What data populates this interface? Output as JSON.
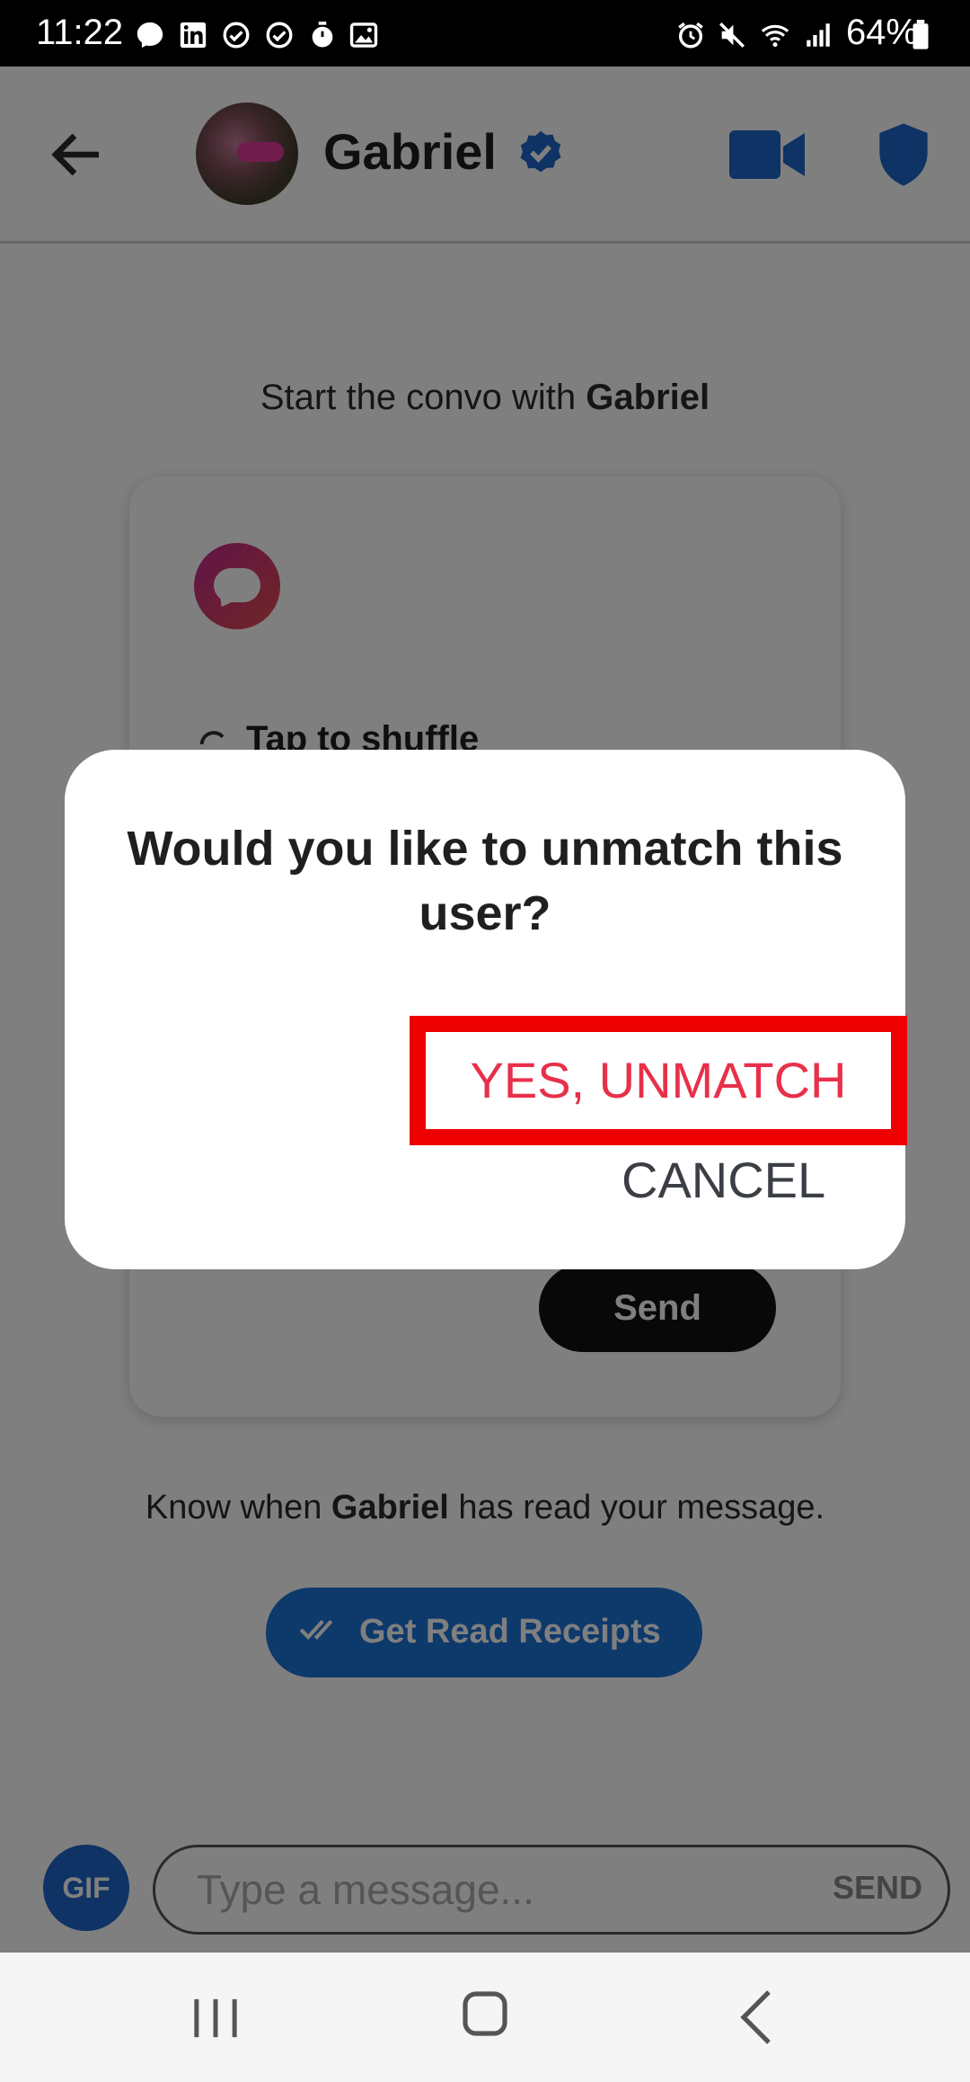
{
  "status_bar": {
    "time": "11:22",
    "battery": "64%",
    "icons": [
      "messenger-icon",
      "linkedin-icon",
      "check-circle-icon",
      "check-circle-icon",
      "timer-icon",
      "image-icon",
      "alarm-icon",
      "mute-icon",
      "wifi-icon",
      "signal-icon",
      "battery-icon"
    ]
  },
  "header": {
    "name": "Gabriel",
    "verified_color": "#1d66c8",
    "accent": "#1d66c8"
  },
  "conversation": {
    "start_prefix": "Start the convo with ",
    "start_name": "Gabriel",
    "shuffle_label": "Tap to shuffle",
    "card_send_label": "Send",
    "read_prefix": "Know when ",
    "read_name": "Gabriel",
    "read_suffix": " has read your message.",
    "read_receipts_label": "Get Read Receipts"
  },
  "composer": {
    "gif_label": "GIF",
    "placeholder": "Type a message...",
    "send_label": "SEND"
  },
  "dialog": {
    "title": "Would you like to unmatch this user?",
    "confirm_label": "YES, UNMATCH",
    "cancel_label": "CANCEL",
    "confirm_color": "#e8304a",
    "highlight_color": "#ef0000"
  }
}
